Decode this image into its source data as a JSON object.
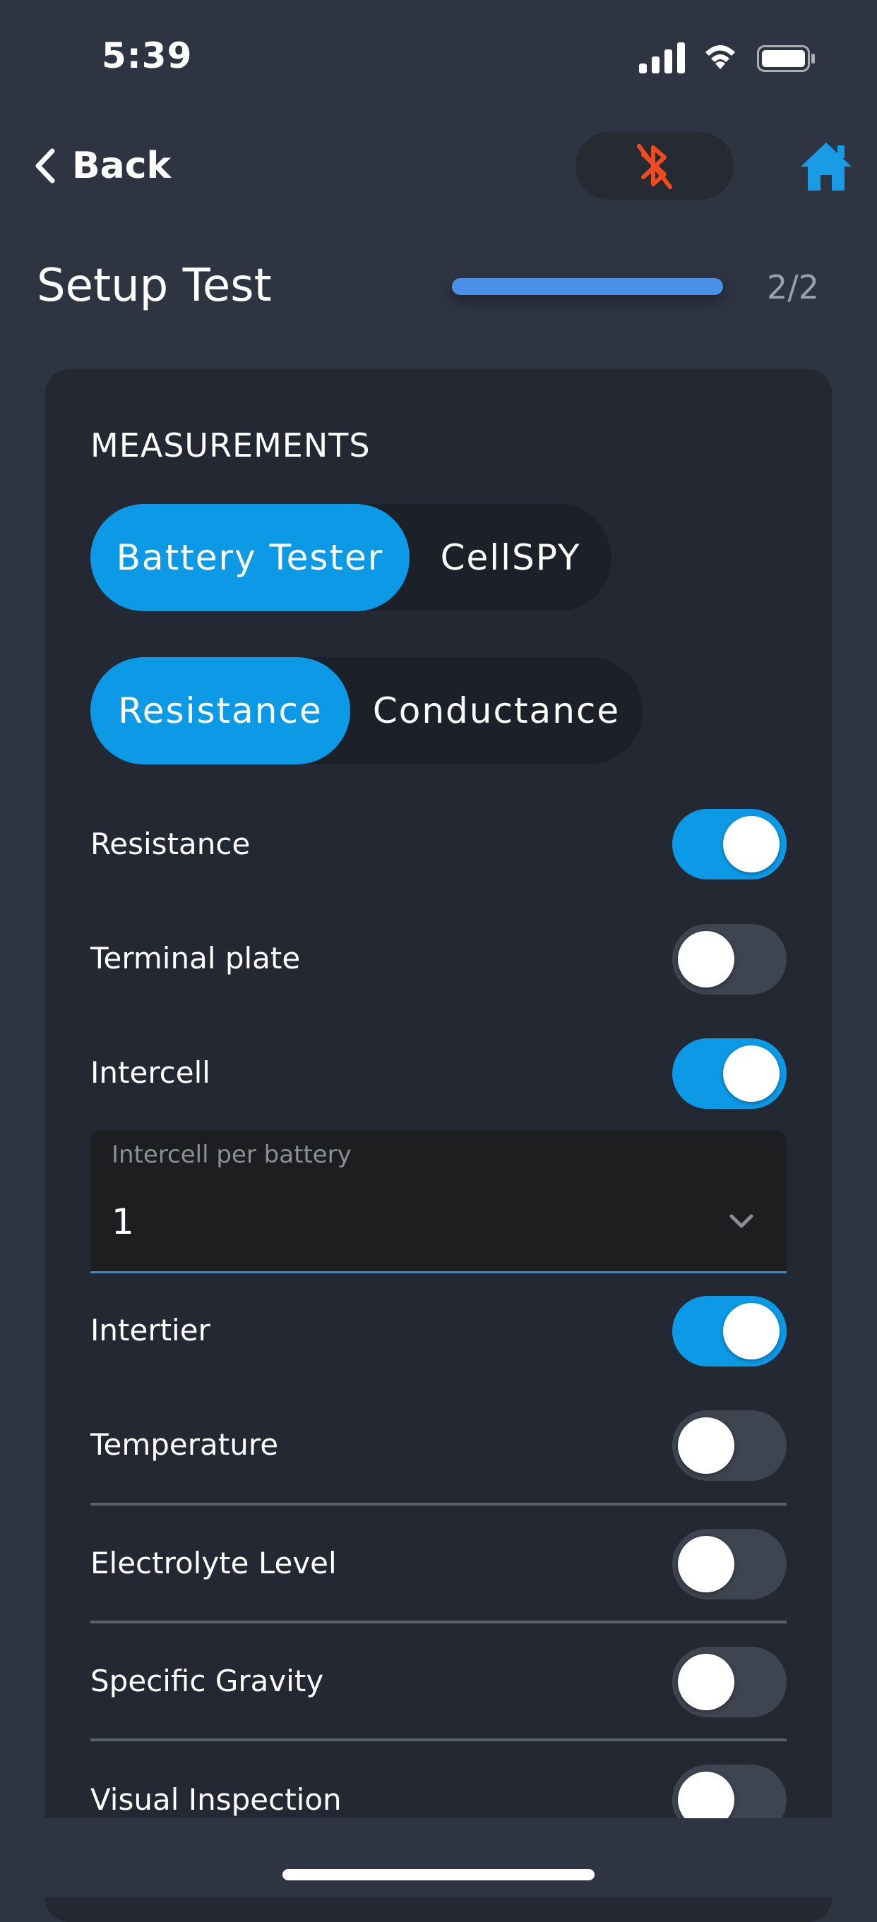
{
  "status_bar": {
    "time": "5:39"
  },
  "nav": {
    "back_label": "Back"
  },
  "header": {
    "title": "Setup Test",
    "step": "2/2",
    "progress": 1.0
  },
  "section": {
    "title": "MEASUREMENTS"
  },
  "device_selector": {
    "options": [
      "Battery Tester",
      "CellSPY"
    ],
    "selected": "Battery Tester"
  },
  "mode_selector": {
    "options": [
      "Resistance",
      "Conductance"
    ],
    "selected": "Resistance"
  },
  "toggles": [
    {
      "label": "Resistance",
      "on": true
    },
    {
      "label": "Terminal plate",
      "on": false
    },
    {
      "label": "Intercell",
      "on": true
    },
    {
      "label": "Intertier",
      "on": true
    },
    {
      "label": "Temperature",
      "on": false
    },
    {
      "label": "Electrolyte Level",
      "on": false
    },
    {
      "label": "Specific Gravity",
      "on": false
    },
    {
      "label": "Visual Inspection",
      "on": false
    }
  ],
  "intercell_select": {
    "label": "Intercell per battery",
    "value": "1"
  },
  "colors": {
    "accent": "#0c9ae6",
    "bluetooth_off": "#f04a1e",
    "home": "#1a9be6",
    "background": "#2e3441",
    "card": "#232833"
  }
}
